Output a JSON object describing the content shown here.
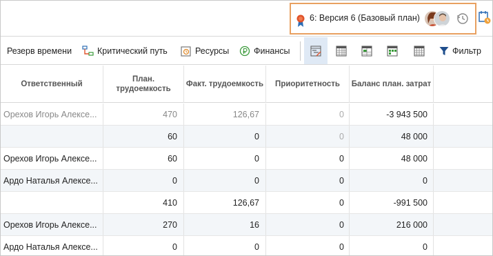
{
  "header": {
    "version_label": "6: Версия 6  (Базовый план)"
  },
  "toolbar": {
    "time_reserve": "Резерв времени",
    "critical_path": "Критический путь",
    "resources": "Ресурсы",
    "finance": "Финансы",
    "filter": "Фильтр"
  },
  "table": {
    "columns": [
      "Ответственный",
      "План. трудоемкость",
      "Факт. трудоемкость",
      "Приоритетность",
      "Баланс план. затрат"
    ],
    "rows": [
      {
        "name": "Орехов Игорь Алексе...",
        "plan": "470",
        "fact": "126,67",
        "prio": "0",
        "balance": "-3 943 500"
      },
      {
        "name": "",
        "plan": "60",
        "fact": "0",
        "prio": "0",
        "balance": "48 000"
      },
      {
        "name": "Орехов Игорь Алексе...",
        "plan": "60",
        "fact": "0",
        "prio": "0",
        "balance": "48 000"
      },
      {
        "name": "Ардо Наталья Алексе...",
        "plan": "0",
        "fact": "0",
        "prio": "0",
        "balance": "0"
      },
      {
        "name": "",
        "plan": "410",
        "fact": "126,67",
        "prio": "0",
        "balance": "-991 500"
      },
      {
        "name": "Орехов Игорь Алексе...",
        "plan": "270",
        "fact": "16",
        "prio": "0",
        "balance": "216 000"
      },
      {
        "name": "Ардо Наталья Алексе...",
        "plan": "0",
        "fact": "0",
        "prio": "0",
        "balance": "0"
      }
    ]
  },
  "colors": {
    "highlight_border": "#e8a060",
    "active_view_bg": "#dfe9f5",
    "filter_icon": "#1f4e8c"
  }
}
